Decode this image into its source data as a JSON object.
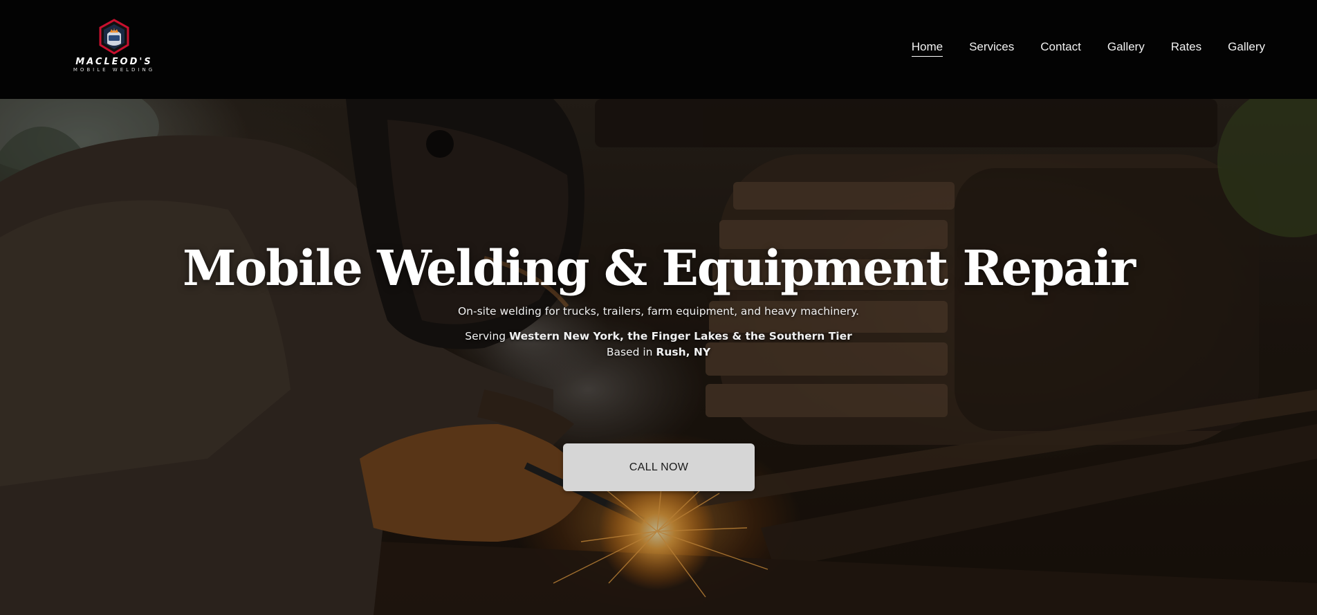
{
  "brand": {
    "name": "MACLEOD'S",
    "tagline": "MOBILE WELDING",
    "colors": {
      "shield_red": "#c8102e",
      "shield_blue": "#2b4a7a",
      "crown_orange": "#f08a24"
    }
  },
  "nav": {
    "items": [
      {
        "label": "Home",
        "active": true
      },
      {
        "label": "Services",
        "active": false
      },
      {
        "label": "Contact",
        "active": false
      },
      {
        "label": "Gallery",
        "active": false
      },
      {
        "label": "Rates",
        "active": false
      },
      {
        "label": "Gallery",
        "active": false
      }
    ]
  },
  "hero": {
    "title": "Mobile Welding & Equipment Repair",
    "subtitle": "On-site welding for trucks, trailers, farm equipment, and heavy machinery.",
    "serving_prefix": "Serving ",
    "serving_area": "Western New York, the Finger Lakes & the Southern Tier",
    "based_prefix": "Based in ",
    "based_location": "Rush, NY",
    "cta_label": "CALL NOW"
  }
}
